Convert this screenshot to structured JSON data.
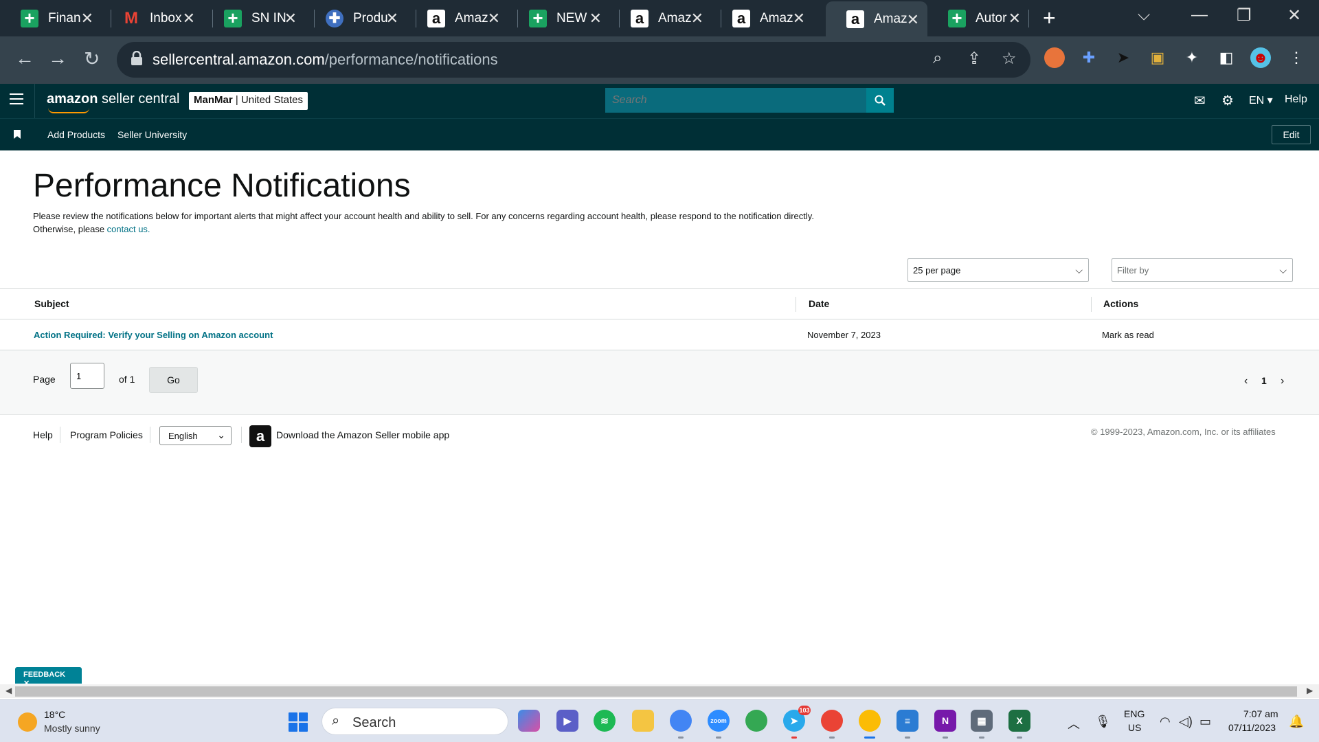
{
  "browser": {
    "tabs": [
      {
        "title": "Finan",
        "icon": "sheets-icon",
        "active": false
      },
      {
        "title": "Inbox",
        "icon": "gmail-icon",
        "active": false
      },
      {
        "title": "SN IN",
        "icon": "sheets-icon",
        "active": false
      },
      {
        "title": "Produ",
        "icon": "plus-circle-icon",
        "active": false
      },
      {
        "title": "Amaz",
        "icon": "amazon-icon",
        "active": false
      },
      {
        "title": "NEW",
        "icon": "sheets-icon",
        "active": false
      },
      {
        "title": "Amaz",
        "icon": "amazon-icon",
        "active": false
      },
      {
        "title": "Amaz",
        "icon": "amazon-icon",
        "active": false
      },
      {
        "title": "Amaz",
        "icon": "amazon-icon",
        "active": true
      },
      {
        "title": "Autor",
        "icon": "sheets-icon",
        "active": false
      }
    ],
    "url_domain": "sellercentral.amazon.com",
    "url_path": "/performance/notifications"
  },
  "header": {
    "logo_bold": "amazon",
    "logo_rest": " seller central",
    "account_name": "ManMar",
    "account_region": " | United States",
    "search_placeholder": "Search",
    "language": "EN",
    "help": "Help",
    "brand_color": "#002f36",
    "accent_color": "#007185"
  },
  "bookmarks": {
    "items": [
      "Add Products",
      "Seller University"
    ],
    "edit_label": "Edit"
  },
  "page": {
    "title": "Performance Notifications",
    "intro_line1": "Please review the notifications below for important alerts that might affect your account health and ability to sell. For any concerns regarding account health, please respond to the notification directly.",
    "intro_line2_prefix": "Otherwise, please ",
    "intro_link": "contact us.",
    "per_page": "25 per page",
    "filter_placeholder": "Filter by"
  },
  "table": {
    "headers": {
      "subject": "Subject",
      "date": "Date",
      "actions": "Actions"
    },
    "rows": [
      {
        "subject": "Action Required: Verify your Selling on Amazon account",
        "date": "November 7, 2023",
        "action": "Mark as read"
      }
    ]
  },
  "pagination": {
    "page_label": "Page",
    "page_value": "1",
    "of_label": "of 1",
    "go_label": "Go",
    "current": "1"
  },
  "footer": {
    "help": "Help",
    "policies": "Program Policies",
    "language": "English",
    "app_text": "Download the Amazon Seller mobile app",
    "copyright": "© 1999-2023, Amazon.com, Inc. or its affiliates"
  },
  "feedback": {
    "label": "FEEDBACK"
  },
  "taskbar": {
    "weather_temp": "18°C",
    "weather_desc": "Mostly sunny",
    "search_label": "Search",
    "telegram_badge": "103",
    "lang_line1": "ENG",
    "lang_line2": "US",
    "time": "7:07 am",
    "date": "07/11/2023"
  }
}
